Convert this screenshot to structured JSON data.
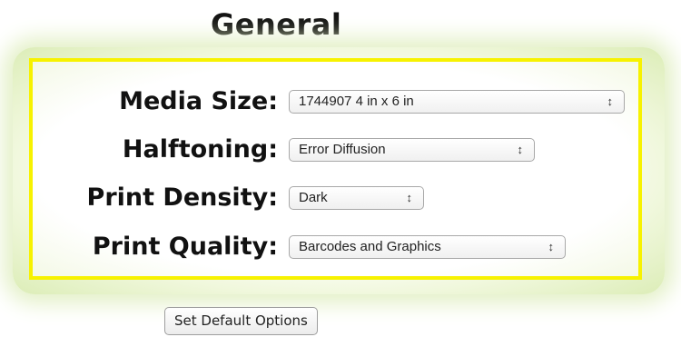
{
  "section": {
    "title": "General"
  },
  "options": [
    {
      "label": "Media Size:",
      "value": "1744907 4 in x 6 in",
      "arrow_icon": "updown-arrows-icon"
    },
    {
      "label": "Halftoning:",
      "value": "Error Diffusion",
      "arrow_icon": "updown-arrows-icon"
    },
    {
      "label": "Print Density:",
      "value": "Dark",
      "arrow_icon": "updown-arrows-icon"
    },
    {
      "label": "Print Quality:",
      "value": "Barcodes and Graphics",
      "arrow_icon": "updown-arrows-icon"
    }
  ],
  "buttons": {
    "set_default": "Set Default Options"
  },
  "colors": {
    "frame": "#f7f200",
    "glow": "#dcedb7"
  }
}
